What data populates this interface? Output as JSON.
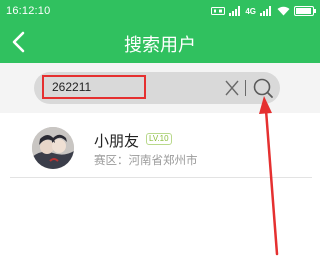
{
  "status_bar": {
    "time": "16:12:10",
    "network_label": "4G",
    "battery_level": 0.85
  },
  "header": {
    "title": "搜索用户",
    "back_icon": "back-arrow-icon"
  },
  "search": {
    "query": "262211",
    "clear_icon": "close-icon",
    "search_icon": "search-icon"
  },
  "results": [
    {
      "name": "小朋友",
      "level": "LV.10",
      "area_label": "赛区：",
      "area_value": "河南省郑州市"
    }
  ],
  "colors": {
    "header_bg": "#30c15f",
    "highlight_box": "#e53030",
    "annotation_arrow": "#e53030",
    "level_text": "#8bbd3e"
  }
}
